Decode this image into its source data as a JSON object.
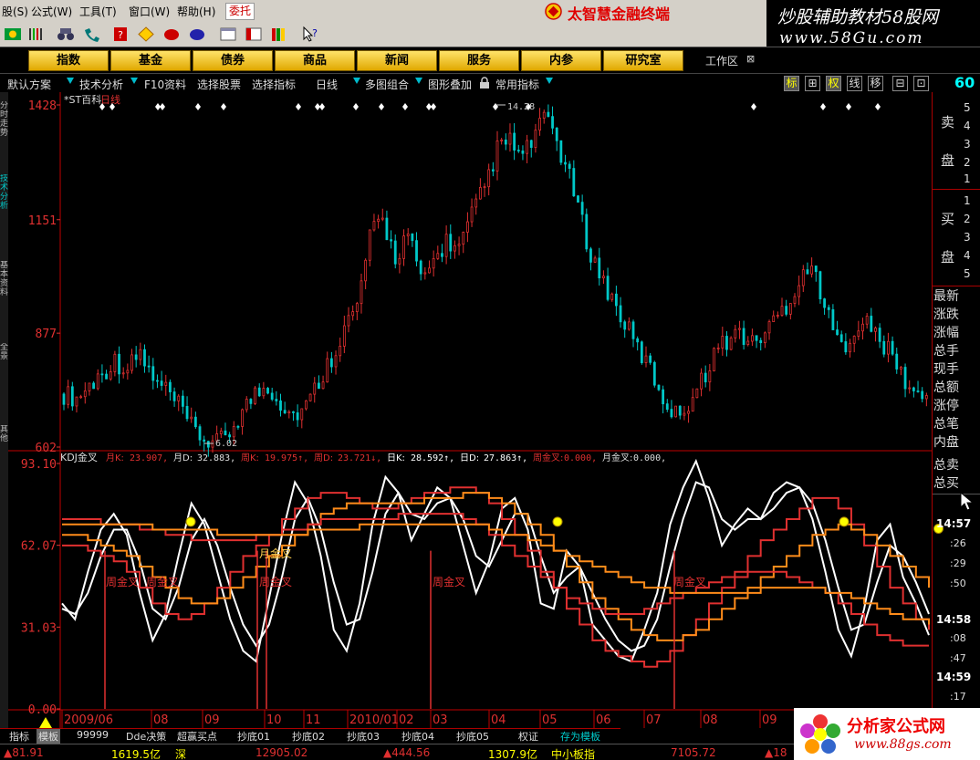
{
  "menu": {
    "items": [
      "股(S)",
      "公式(W)",
      "工具(T)",
      "窗口(W)",
      "帮助(H)"
    ],
    "weituo": "委托",
    "title": "太智慧金融终端"
  },
  "watermark_top": {
    "line1": "炒股辅助教材58股网",
    "line2": "www.58Gu.com"
  },
  "nav": {
    "buttons": [
      "指数",
      "基金",
      "债券",
      "商品",
      "新闻",
      "服务",
      "内参",
      "研究室"
    ],
    "workarea": "工作区",
    "workarea_close": "⊠"
  },
  "toolbar2": {
    "items": [
      "默认方案",
      "技术分析",
      "F10资料",
      "选择股票",
      "选择指标",
      "日线",
      "多图组合",
      "图形叠加",
      "常用指标"
    ],
    "right_boxes": [
      "标",
      "⊞",
      "权",
      "线",
      "移",
      "⊟",
      "⊡"
    ],
    "right_number": "60"
  },
  "left_strip": [
    "分时走势",
    "技术分析",
    "基本资料",
    "全景",
    "其他"
  ],
  "colors": {
    "red": "#e03030",
    "axis": "#c00000",
    "white": "#ffffff",
    "orange": "#ff8c1a",
    "cyan": "#00c8c8",
    "pink": "#ff6060"
  },
  "chart_data": [
    {
      "type": "candlestick",
      "title": "*ST百科 日线",
      "title_name": "*ST百科",
      "title_period": "日线",
      "y_ticks": [
        "1428",
        "1151",
        "877",
        "602"
      ],
      "ylim": [
        6.02,
        14.28
      ],
      "annotations": [
        {
          "text": "14.28",
          "value": 14.28
        },
        {
          "text": "6.02",
          "value": 6.02
        }
      ],
      "close_series_approx": [
        7.3,
        7.2,
        7.5,
        7.8,
        8.1,
        7.9,
        8.3,
        7.6,
        7.4,
        7.0,
        6.5,
        6.2,
        6.1,
        6.4,
        6.9,
        7.3,
        7.5,
        7.1,
        6.8,
        7.0,
        7.6,
        8.2,
        8.9,
        9.4,
        11.1,
        11.5,
        10.6,
        11.2,
        10.0,
        10.5,
        11.0,
        10.8,
        11.6,
        12.3,
        13.2,
        13.4,
        13.0,
        13.6,
        14.0,
        13.1,
        12.2,
        11.0,
        10.2,
        9.6,
        9.0,
        8.4,
        7.9,
        7.2,
        6.8,
        7.1,
        7.6,
        8.3,
        8.6,
        8.8,
        8.5,
        8.8,
        9.2,
        9.6,
        10.3,
        10.2,
        9.1,
        8.4,
        8.9,
        9.0,
        8.6,
        8.2,
        7.6,
        7.2
      ]
    },
    {
      "type": "line",
      "title": "KDJ金叉",
      "legend": [
        {
          "name": "月K:",
          "value": "23.907,"
        },
        {
          "name": "月D:",
          "value": "32.883,"
        },
        {
          "name": "周K:",
          "value": "19.975↑,"
        },
        {
          "name": "周D:",
          "value": "23.721↓,"
        },
        {
          "name": "日K:",
          "value": "28.592↑,"
        },
        {
          "name": "日D:",
          "value": "27.863↑,"
        },
        {
          "name": "周金叉:",
          "value": "0.000,"
        },
        {
          "name": "月金叉:",
          "value": "0.000,"
        }
      ],
      "y_ticks": [
        "93.10",
        "62.07",
        "31.03",
        "0.00"
      ],
      "ylim": [
        0,
        93.1
      ],
      "x_ticks": [
        "2009/06",
        "08",
        "09",
        "10",
        "11",
        "2010/01",
        "02",
        "03",
        "04",
        "05",
        "06",
        "07",
        "08",
        "09"
      ],
      "cross_labels": [
        {
          "text": "周金叉",
          "x_index": 3
        },
        {
          "text": "周金叉",
          "x_index": 6
        },
        {
          "text": "月金叉",
          "x_index": 18
        },
        {
          "text": "周金叉",
          "x_index": 18
        },
        {
          "text": "周金叉",
          "x_index": 32
        },
        {
          "text": "周金叉",
          "x_index": 52
        }
      ],
      "series": [
        {
          "name": "日K",
          "color": "#ffffff",
          "values": [
            40,
            34,
            52,
            68,
            74,
            66,
            44,
            26,
            36,
            58,
            78,
            70,
            52,
            34,
            22,
            18,
            42,
            66,
            86,
            78,
            58,
            30,
            22,
            40,
            70,
            88,
            82,
            64,
            74,
            84,
            80,
            62,
            44,
            56,
            76,
            80,
            68,
            40,
            38,
            60,
            54,
            32,
            26,
            20,
            18,
            30,
            44,
            70,
            84,
            94,
            80,
            62,
            70,
            76,
            72,
            82,
            86,
            84,
            72,
            52,
            30,
            20,
            38,
            64,
            70,
            50,
            40,
            28
          ]
        },
        {
          "name": "日D",
          "color": "#ffffff",
          "values": [
            38,
            36,
            44,
            58,
            68,
            68,
            56,
            38,
            34,
            46,
            64,
            72,
            62,
            46,
            32,
            24,
            32,
            50,
            72,
            80,
            68,
            48,
            32,
            34,
            52,
            74,
            82,
            74,
            72,
            78,
            80,
            72,
            58,
            54,
            64,
            74,
            74,
            58,
            44,
            50,
            54,
            44,
            34,
            26,
            22,
            24,
            34,
            54,
            72,
            86,
            84,
            72,
            68,
            72,
            72,
            76,
            82,
            84,
            78,
            64,
            46,
            30,
            32,
            48,
            62,
            58,
            48,
            36
          ]
        },
        {
          "name": "周K",
          "color": "#e03030",
          "values": [
            62,
            62,
            60,
            58,
            56,
            52,
            46,
            40,
            36,
            34,
            36,
            40,
            46,
            52,
            58,
            62,
            66,
            72,
            76,
            80,
            82,
            82,
            80,
            78,
            76,
            76,
            78,
            80,
            82,
            82,
            84,
            84,
            82,
            78,
            72,
            66,
            60,
            52,
            46,
            38,
            32,
            26,
            22,
            20,
            18,
            16,
            18,
            22,
            28,
            34,
            40,
            46,
            52,
            58,
            64,
            68,
            72,
            76,
            80,
            80,
            76,
            70,
            62,
            54,
            46,
            40,
            34,
            30
          ]
        },
        {
          "name": "周D",
          "color": "#ff8c1a",
          "values": [
            66,
            66,
            64,
            62,
            60,
            58,
            54,
            50,
            46,
            42,
            40,
            40,
            42,
            46,
            50,
            54,
            58,
            62,
            66,
            70,
            74,
            76,
            78,
            78,
            78,
            78,
            78,
            78,
            80,
            80,
            80,
            82,
            82,
            80,
            78,
            74,
            70,
            66,
            60,
            54,
            48,
            42,
            38,
            34,
            30,
            28,
            26,
            26,
            28,
            30,
            34,
            38,
            42,
            46,
            50,
            54,
            58,
            62,
            66,
            68,
            70,
            68,
            66,
            62,
            58,
            54,
            50,
            46
          ]
        },
        {
          "name": "月K",
          "color": "#e03030",
          "values": [
            72,
            72,
            72,
            70,
            70,
            70,
            68,
            68,
            66,
            66,
            64,
            64,
            64,
            64,
            64,
            66,
            66,
            68,
            68,
            70,
            72,
            72,
            72,
            72,
            72,
            72,
            74,
            74,
            74,
            74,
            74,
            72,
            70,
            66,
            62,
            58,
            54,
            50,
            46,
            42,
            40,
            38,
            36,
            36,
            36,
            38,
            40,
            42,
            44,
            46,
            48,
            50,
            50,
            52,
            52,
            52,
            50,
            48,
            46,
            44,
            40,
            36,
            32,
            28,
            26,
            24,
            24,
            24
          ]
        },
        {
          "name": "月D",
          "color": "#ff8c1a",
          "values": [
            70,
            70,
            70,
            70,
            70,
            70,
            70,
            68,
            68,
            68,
            68,
            68,
            66,
            66,
            66,
            66,
            66,
            66,
            66,
            68,
            68,
            68,
            68,
            70,
            70,
            70,
            70,
            70,
            70,
            70,
            70,
            70,
            70,
            68,
            66,
            66,
            64,
            62,
            60,
            58,
            56,
            54,
            52,
            50,
            48,
            46,
            46,
            44,
            44,
            44,
            44,
            44,
            44,
            44,
            46,
            46,
            46,
            46,
            46,
            44,
            44,
            42,
            40,
            38,
            36,
            34,
            34,
            32
          ]
        }
      ]
    }
  ],
  "right_panel": {
    "sell_label_1": "卖",
    "sell_label_2": "盘",
    "buy_label_1": "买",
    "buy_label_2": "盘",
    "sell_levels": [
      "5",
      "4",
      "3",
      "2",
      "1"
    ],
    "buy_levels": [
      "1",
      "2",
      "3",
      "4",
      "5"
    ],
    "fields": [
      "最新",
      "涨跌",
      "涨幅",
      "总手",
      "现手",
      "总额",
      "涨停",
      "总笔",
      "内盘",
      "总卖",
      "总买"
    ],
    "times": [
      {
        "t": "14:57",
        "big": true
      },
      {
        "t": ":26",
        "big": false
      },
      {
        "t": ":29",
        "big": false
      },
      {
        "t": ":50",
        "big": false
      },
      {
        "t": "14:58",
        "big": true
      },
      {
        "t": ":08",
        "big": false
      },
      {
        "t": ":47",
        "big": false
      },
      {
        "t": "14:59",
        "big": true
      },
      {
        "t": ":17",
        "big": false
      }
    ]
  },
  "bottom_tabs": {
    "period": "日线",
    "items": [
      "指标",
      "模板",
      "99999",
      "Dde决策",
      "超赢买点",
      "抄底01",
      "抄底02",
      "抄底03",
      "抄底04",
      "抄底05",
      "权证",
      "存为模板"
    ]
  },
  "status_bar": {
    "items": [
      {
        "text": "▲81.91",
        "color": "#e03030"
      },
      {
        "text": "1619.5亿",
        "color": "#ffff00"
      },
      {
        "text": "深",
        "color": "#ffff00"
      },
      {
        "text": "12905.02",
        "color": "#e03030"
      },
      {
        "text": "▲444.56",
        "color": "#e03030"
      },
      {
        "text": "1307.9亿",
        "color": "#ffff00"
      },
      {
        "text": "中小板指",
        "color": "#ffff00"
      },
      {
        "text": "7105.72",
        "color": "#e03030"
      },
      {
        "text": "▲18",
        "color": "#e03030"
      }
    ]
  },
  "watermark_bottom": {
    "line1": "分析家公式网",
    "line2": "www.88gs.com"
  }
}
